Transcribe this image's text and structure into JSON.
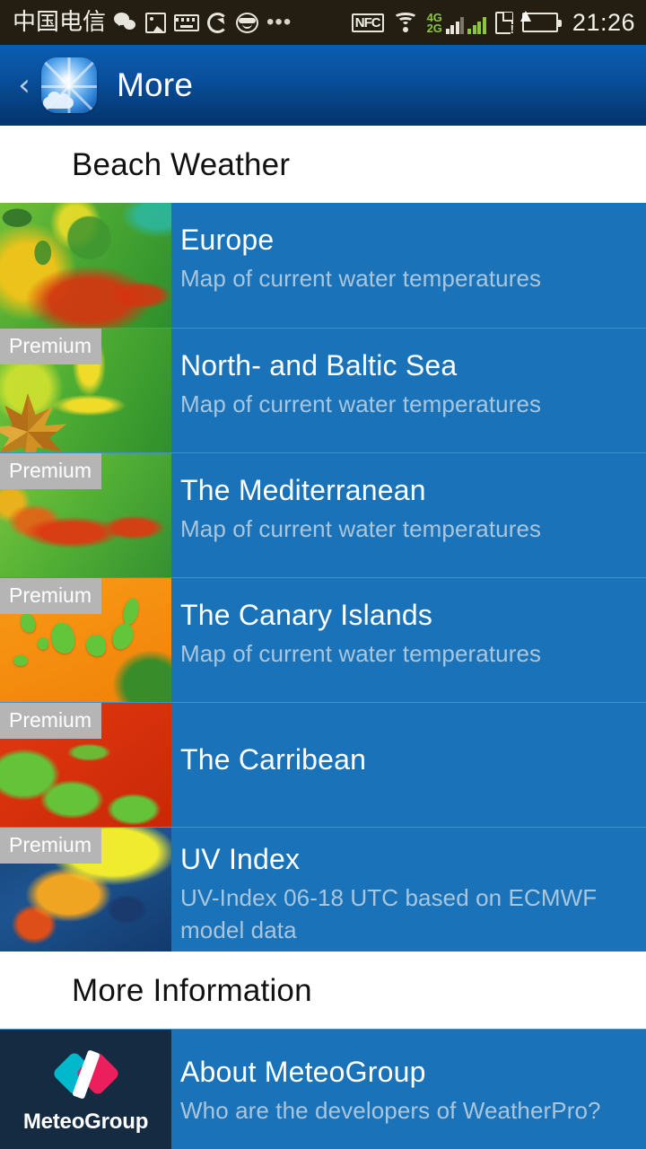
{
  "status_bar": {
    "carrier": "中国电信",
    "time": "21:26",
    "nfc_label": "NFC",
    "network_4g": "4G",
    "network_2g": "2G",
    "left_icons": [
      "wechat-icon",
      "photo-icon",
      "keyboard-icon",
      "sync-icon",
      "smiley-icon",
      "more-dots-icon"
    ],
    "right_icons": [
      "nfc-icon",
      "wifi-icon",
      "signal-icon",
      "sim-card-icon",
      "battery-charging-icon"
    ]
  },
  "appbar": {
    "back_label": "‹",
    "title": "More",
    "icon": "weather-app-icon"
  },
  "sections": [
    {
      "title": "Beach Weather",
      "items": [
        {
          "title": "Europe",
          "subtitle": "Map of current water temperatures",
          "premium": "",
          "thumb": "m-europe"
        },
        {
          "title": "North- and Baltic Sea",
          "subtitle": "Map of current water temperatures",
          "premium": "Premium",
          "thumb": "m-baltic"
        },
        {
          "title": "The Mediterranean",
          "subtitle": "Map of current water temperatures",
          "premium": "Premium",
          "thumb": "m-medi"
        },
        {
          "title": "The Canary Islands",
          "subtitle": "Map of current water temperatures",
          "premium": "Premium",
          "thumb": "m-canary"
        },
        {
          "title": "The Carribean",
          "subtitle": "",
          "premium": "Premium",
          "thumb": "m-carib"
        },
        {
          "title": "UV Index",
          "subtitle": "UV-Index 06-18 UTC based on ECMWF model data",
          "premium": "Premium",
          "thumb": "m-uv"
        }
      ]
    },
    {
      "title": "More Information",
      "items": [
        {
          "title": "About MeteoGroup",
          "subtitle": "Who are the developers of WeatherPro?",
          "premium": "",
          "thumb": "m-meteo",
          "logo_word": "MeteoGroup"
        }
      ]
    }
  ],
  "colors": {
    "row_blue": "#1a72b8",
    "header_blue_top": "#0b5cb0",
    "header_blue_bottom": "#02346c",
    "subtitle_grey": "#a8c6de",
    "premium_badge": "#b5b5b5",
    "meteogroup_navy": "#152b42",
    "meteogroup_teal": "#00b8cc",
    "meteogroup_pink": "#ea1f5c"
  }
}
